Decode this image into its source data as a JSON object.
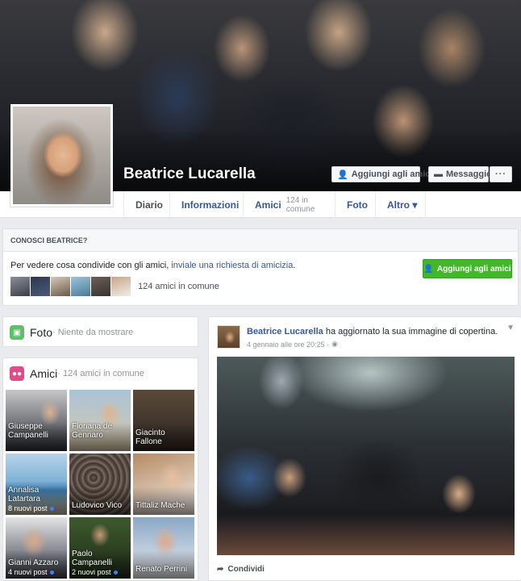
{
  "profile": {
    "name": "Beatrice Lucarella",
    "add_friend_label": "Aggiungi agli amici",
    "message_label": "Messaggio",
    "more_label": "···"
  },
  "nav": {
    "tabs": [
      {
        "label": "Diario"
      },
      {
        "label": "Informazioni"
      },
      {
        "label": "Amici",
        "sub": "124 in comune"
      },
      {
        "label": "Foto"
      },
      {
        "label": "Altro ▾"
      }
    ]
  },
  "know": {
    "header": "CONOSCI BEATRICE?",
    "text_before": "Per vedere cosa condivide con gli amici, ",
    "link": "inviale una richiesta di amicizia",
    "text_after": ".",
    "button_label": "Aggiungi agli amici",
    "mutual": "124 amici in comune"
  },
  "photos_card": {
    "title": "Foto",
    "meta": " · Niente da mostrare"
  },
  "friends_card": {
    "title": "Amici",
    "meta": " · 124 amici in comune",
    "friends": [
      {
        "name": "Giuseppe Campanelli",
        "posts": ""
      },
      {
        "name": "Floriana de Gennaro",
        "posts": ""
      },
      {
        "name": "Giacinto Fallone",
        "posts": ""
      },
      {
        "name": "Annalisa Latartara",
        "posts": "8 nuovi post"
      },
      {
        "name": "Ludovico Vico",
        "posts": ""
      },
      {
        "name": "Tittaliz Mache",
        "posts": ""
      },
      {
        "name": "Gianni Azzaro",
        "posts": "4 nuovi post"
      },
      {
        "name": "Paolo Campanelli",
        "posts": "2 nuovi post"
      },
      {
        "name": "Renato Perrini",
        "posts": ""
      }
    ]
  },
  "post": {
    "author": "Beatrice Lucarella",
    "action": " ha aggiornato la sua immagine di copertina.",
    "date": "4 gennaio alle ore 20:25 · ",
    "share_label": "Condividi"
  },
  "colors": {
    "link": "#365899",
    "green": "#42b72a",
    "bg": "#e9ebee"
  }
}
